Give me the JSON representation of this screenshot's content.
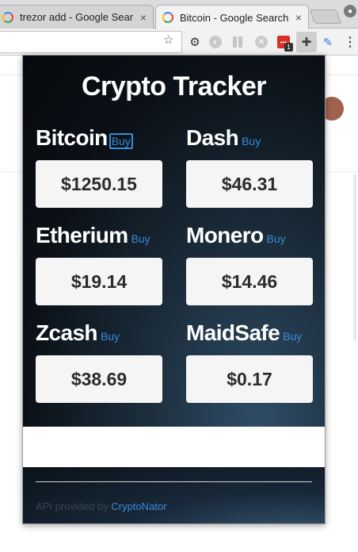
{
  "browser": {
    "tabs": [
      {
        "title": "trezor add - Google Sear",
        "close": "×",
        "active": false
      },
      {
        "title": "Bitcoin - Google Search",
        "close": "×",
        "active": true
      }
    ],
    "kebab": "⋮"
  },
  "popup": {
    "title": "Crypto Tracker",
    "buy_label": "Buy",
    "coins": [
      {
        "name": "Bitcoin",
        "price": "$1250.15"
      },
      {
        "name": "Dash",
        "price": "$46.31"
      },
      {
        "name": "Etherium",
        "price": "$19.14"
      },
      {
        "name": "Monero",
        "price": "$14.46"
      },
      {
        "name": "Zcash",
        "price": "$38.69"
      },
      {
        "name": "MaidSafe",
        "price": "$0.17"
      }
    ],
    "footer": {
      "prefix": "API provided by ",
      "link": "CryptoNator"
    }
  },
  "colors": {
    "link": "#3a8bd8",
    "price_bg": "#f5f5f5",
    "title": "#ffffff"
  },
  "icons": [
    "google-favicon-icon",
    "close-icon",
    "star-icon",
    "gear-icon",
    "puzzle-icon",
    "eyedropper-icon",
    "kebab-menu-icon"
  ]
}
